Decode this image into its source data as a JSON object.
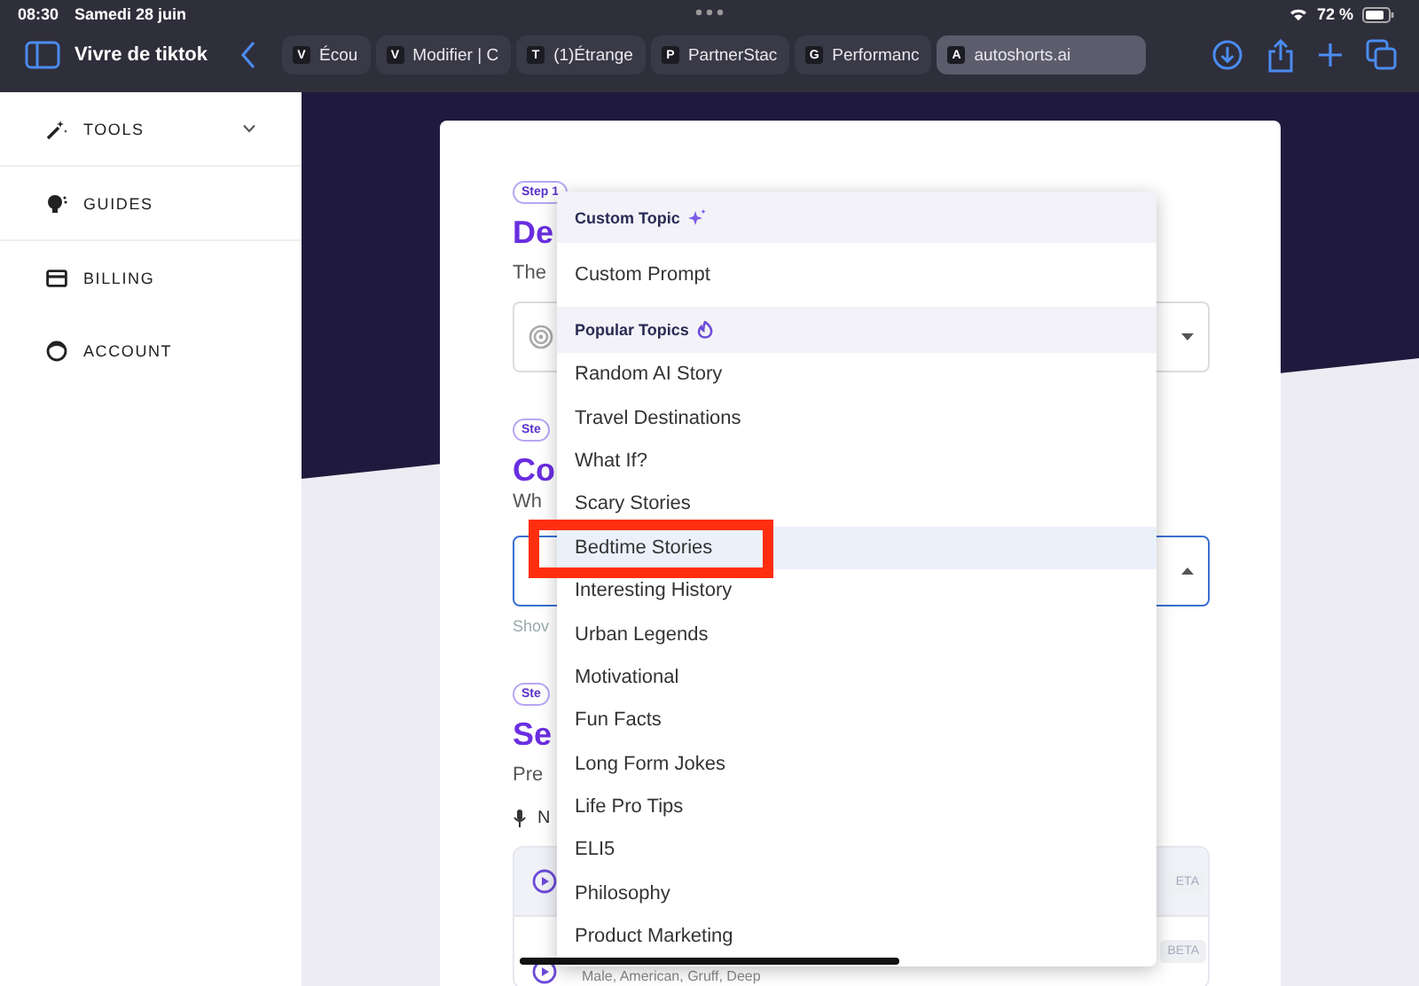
{
  "status_bar": {
    "time": "08:30",
    "date": "Samedi 28 juin",
    "battery": "72 %"
  },
  "toolbar": {
    "title": "Vivre de tiktok"
  },
  "tabs": [
    {
      "favicon": "V",
      "label": "Écou",
      "selected": false
    },
    {
      "favicon": "V",
      "label": "Modifier | C",
      "selected": false
    },
    {
      "favicon": "T",
      "label": "(1)Étrange",
      "selected": false
    },
    {
      "favicon": "P",
      "label": "PartnerStac",
      "selected": false
    },
    {
      "favicon": "G",
      "label": "Performanc",
      "selected": false
    },
    {
      "favicon": "A",
      "label": "autoshorts.ai",
      "selected": true
    }
  ],
  "sidebar": {
    "items": [
      {
        "label": "TOOLS",
        "expandable": true
      },
      {
        "label": "GUIDES",
        "expandable": false
      },
      {
        "label": "BILLING",
        "expandable": false
      },
      {
        "label": "ACCOUNT",
        "expandable": false
      }
    ]
  },
  "form": {
    "step1": {
      "badge": "Step 1",
      "heading": "De",
      "text": "The",
      "expanded": false
    },
    "step2": {
      "badge": "Ste",
      "heading": "Co",
      "text": "Wh",
      "expanded": true,
      "hint": "Shov"
    },
    "step3": {
      "badge": "Ste",
      "heading": "Se",
      "text": "Pre",
      "label": "N"
    },
    "voices": [
      {
        "badge": "ETA"
      },
      {
        "detail": "Male, American, Gruff, Deep",
        "badge": "BETA"
      }
    ]
  },
  "dropdown": {
    "items": [
      {
        "kind": "group",
        "label": "Custom Topic"
      },
      {
        "kind": "option",
        "label": "Custom Prompt",
        "selected": false
      },
      {
        "kind": "group",
        "label": "Popular Topics"
      },
      {
        "kind": "option",
        "label": "Random AI Story",
        "selected": false
      },
      {
        "kind": "option",
        "label": "Travel Destinations",
        "selected": false
      },
      {
        "kind": "option",
        "label": "What If?",
        "selected": false
      },
      {
        "kind": "option",
        "label": "Scary Stories",
        "selected": false
      },
      {
        "kind": "option",
        "label": "Bedtime Stories",
        "selected": true
      },
      {
        "kind": "option",
        "label": "Interesting History",
        "selected": false
      },
      {
        "kind": "option",
        "label": "Urban Legends",
        "selected": false
      },
      {
        "kind": "option",
        "label": "Motivational",
        "selected": false
      },
      {
        "kind": "option",
        "label": "Fun Facts",
        "selected": false
      },
      {
        "kind": "option",
        "label": "Long Form Jokes",
        "selected": false
      },
      {
        "kind": "option",
        "label": "Life Pro Tips",
        "selected": false
      },
      {
        "kind": "option",
        "label": "ELI5",
        "selected": false
      },
      {
        "kind": "option",
        "label": "Philosophy",
        "selected": false
      },
      {
        "kind": "option",
        "label": "Product Marketing",
        "selected": false
      }
    ]
  }
}
